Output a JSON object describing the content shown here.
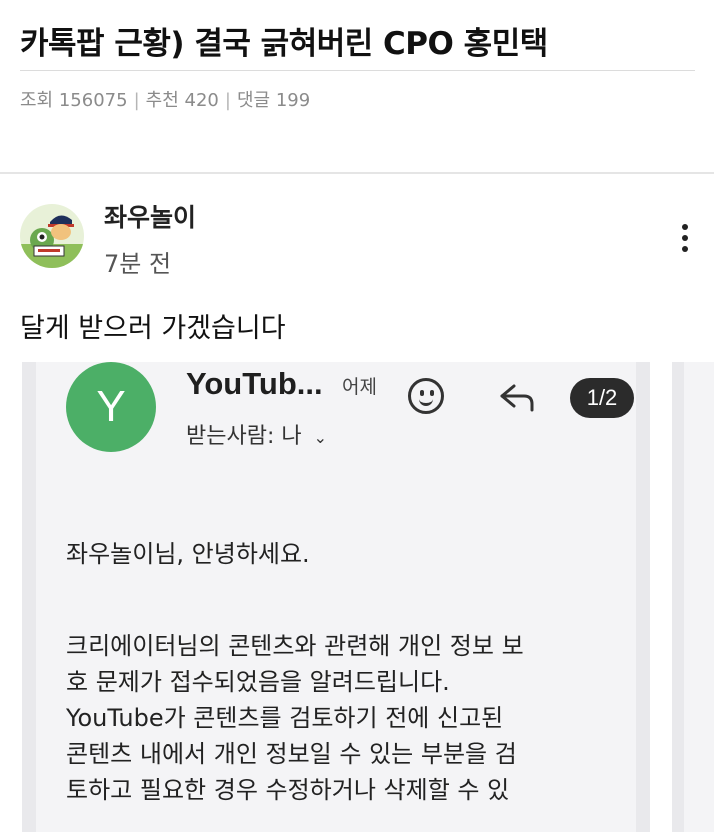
{
  "post": {
    "title": "카톡팝 근황) 결국 긁혀버린 CPO 홍민택",
    "stats": {
      "views_label": "조회",
      "views": "156075",
      "recommend_label": "추천",
      "recommend": "420",
      "comments_label": "댓글",
      "comments": "199",
      "separator": "|"
    },
    "author": {
      "name": "좌우놀이",
      "time": "7분 전"
    },
    "body_text": "달게 받으러 가겠습니다"
  },
  "email_screenshot": {
    "avatar_letter": "Y",
    "sender": "YouTub...",
    "date": "어제",
    "counter": "1/2",
    "recipient": "받는사람: 나",
    "greeting": "좌우놀이님, 안녕하세요.",
    "body_lines": [
      "크리에이터님의 콘텐츠와 관련해 개인 정보 보",
      "호 문제가 접수되었음을 알려드립니다.",
      "YouTube가 콘텐츠를 검토하기 전에 신고된",
      "콘텐츠 내에서 개인 정보일 수 있는 부분을 검",
      "토하고 필요한 경우 수정하거나 삭제할 수 있"
    ],
    "icons": [
      "emoji-icon",
      "reply-icon",
      "chevron-down-icon"
    ]
  },
  "colors": {
    "avatar_green": "#4caf67",
    "counter_bg": "#2b2b2b",
    "meta_gray": "#8b8b8b"
  }
}
